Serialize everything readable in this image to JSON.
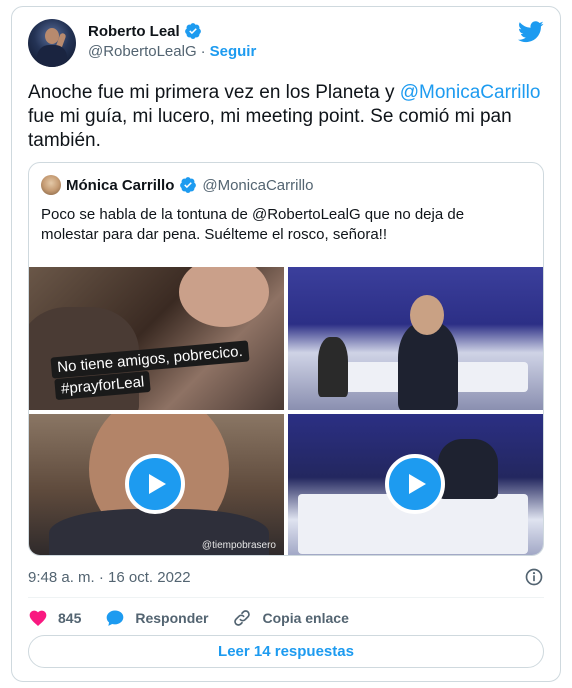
{
  "author": {
    "name": "Roberto Leal",
    "handle": "@RobertoLealG",
    "follow_label": "Seguir",
    "verified_icon": "verified-badge-icon"
  },
  "tweet": {
    "text_part1": "Anoche fue mi primera vez en los Planeta y ",
    "mention": "@MonicaCarrillo",
    "text_part2": " fue mi guía, mi lucero, mi meeting point. Se comió mi pan también."
  },
  "quoted": {
    "name": "Mónica Carrillo",
    "handle": "@MonicaCarrillo",
    "text": "Poco se habla de la tontuna de @RobertoLealG que no deja de molestar para dar pena. Suélteme el rosco, señora!!",
    "media": {
      "sticker_line1": "No tiene amigos, pobrecico.",
      "sticker_line2": "#prayforLeal",
      "watermark": "@tiempobrasero"
    }
  },
  "timestamp": "9:48 a. m. · 16 oct. 2022",
  "actions": {
    "like_count": "845",
    "reply_label": "Responder",
    "copy_label": "Copia enlace"
  },
  "read_replies_label": "Leer 14 respuestas",
  "colors": {
    "accent": "#1d9bf0",
    "like": "#f91880",
    "text": "#0f1419",
    "secondary": "#536471"
  }
}
